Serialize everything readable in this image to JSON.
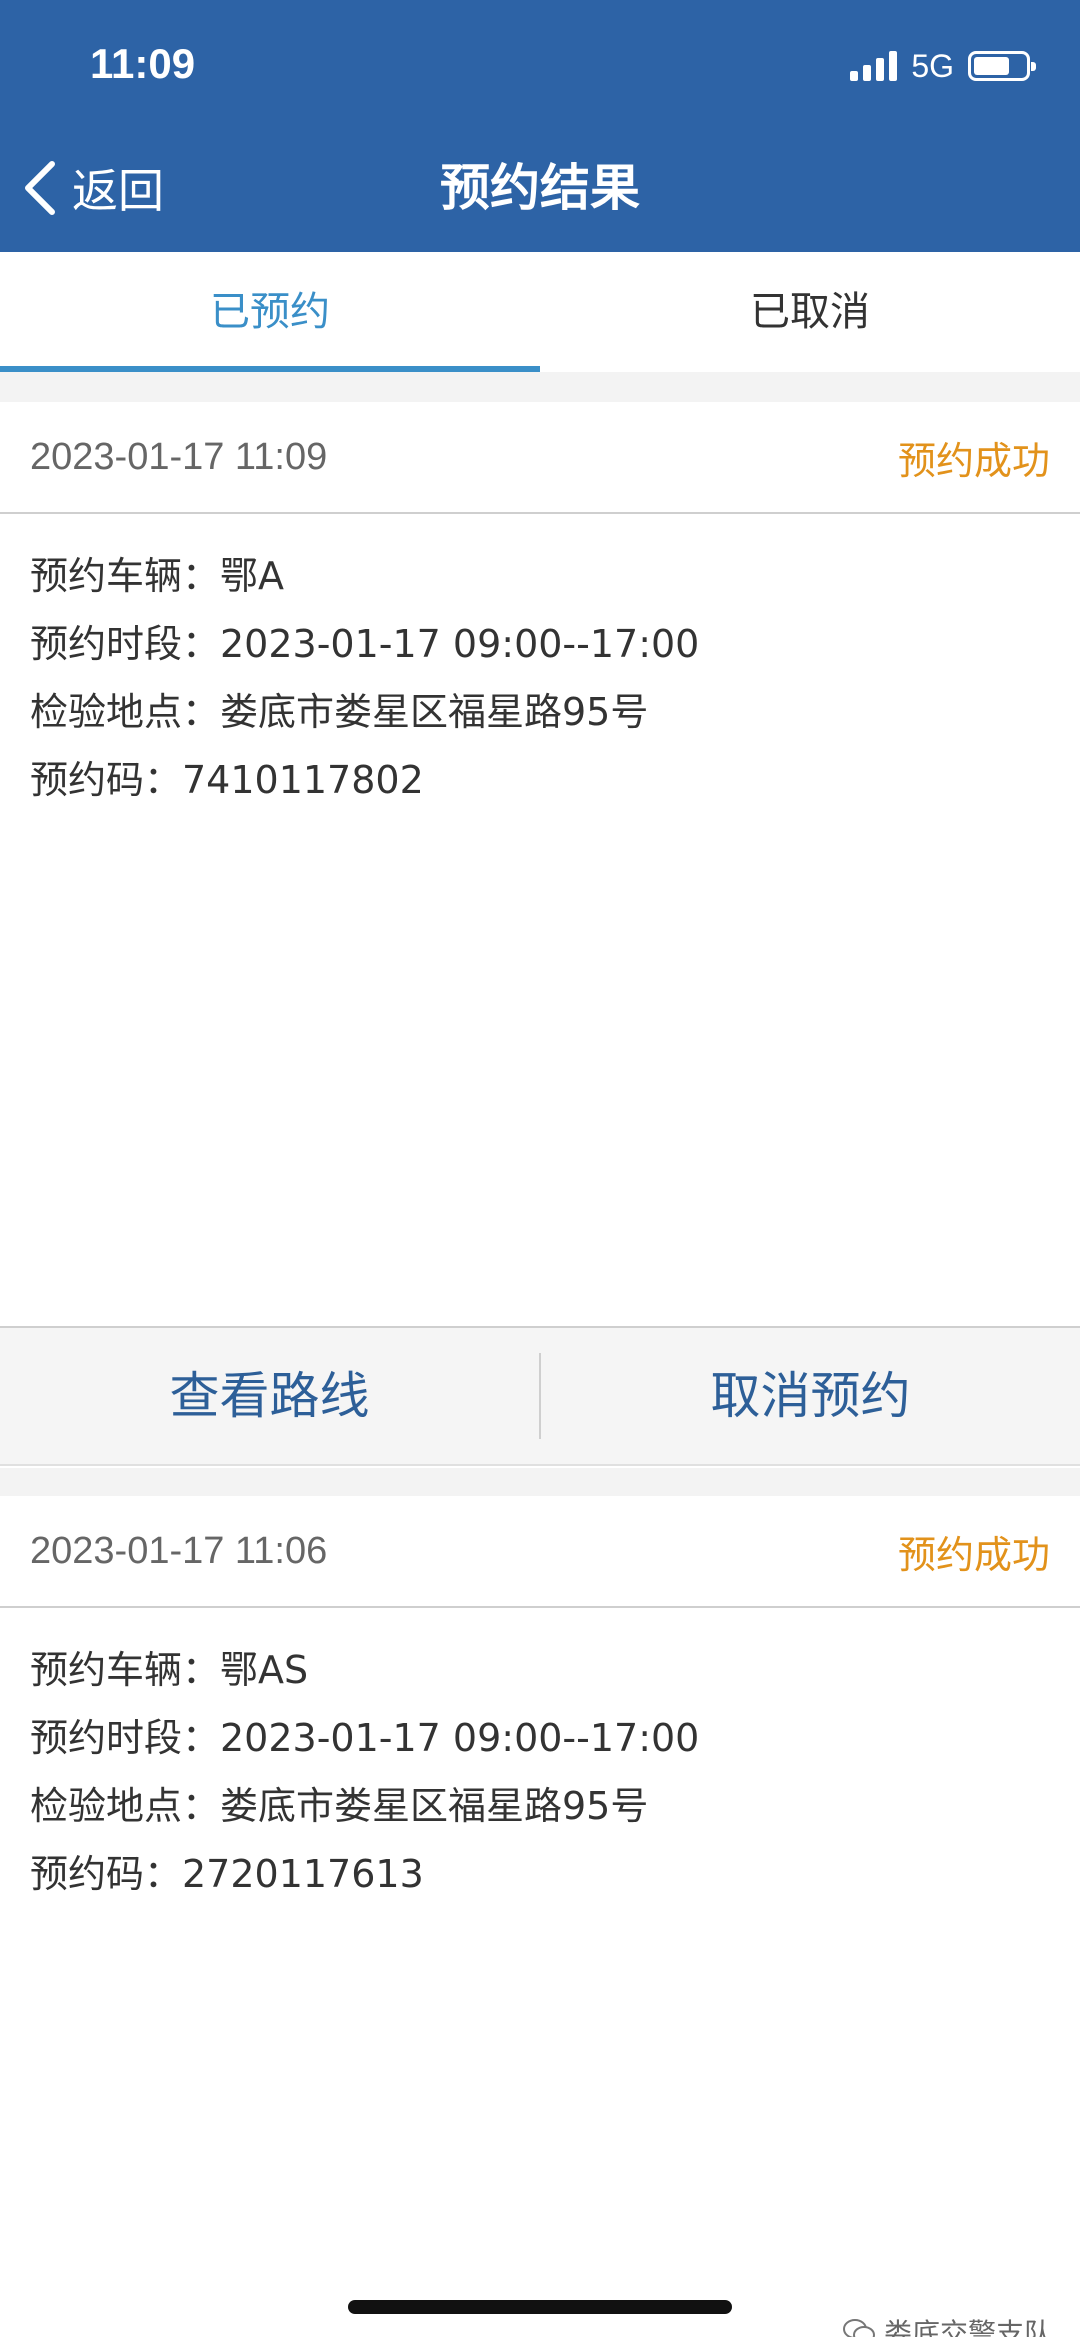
{
  "status_bar": {
    "time": "11:09",
    "network": "5G"
  },
  "nav": {
    "back_label": "返回",
    "title": "预约结果"
  },
  "tabs": [
    {
      "label": "已预约",
      "active": true
    },
    {
      "label": "已取消",
      "active": false
    }
  ],
  "records": [
    {
      "time": "2023-01-17 11:09",
      "status": "预约成功",
      "vehicle": "预约车辆：鄂A",
      "period": "预约时段：2023-01-17 09:00--17:00",
      "location": "检验地点：娄底市娄星区福星路95号",
      "code": "预约码：7410117802"
    },
    {
      "time": "2023-01-17 11:06",
      "status": "预约成功",
      "vehicle": "预约车辆：鄂AS",
      "period": "预约时段：2023-01-17 09:00--17:00",
      "location": "检验地点：娄底市娄星区福星路95号",
      "code": "预约码：2720117613"
    }
  ],
  "actions": {
    "view_route": "查看路线",
    "cancel": "取消预约"
  },
  "watermark": "娄底交警支队",
  "colors": {
    "header": "#2d63a6",
    "tab_active": "#3a8fc8",
    "status_success": "#e2921b",
    "action_text": "#2d5f98"
  }
}
